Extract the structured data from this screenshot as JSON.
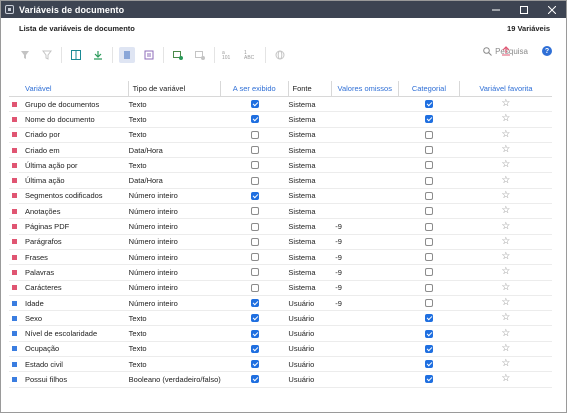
{
  "window": {
    "title": "Variáveis de documento"
  },
  "subheader": {
    "title": "Lista de variáveis de documento",
    "count": "19 Variáveis"
  },
  "toolbar": {
    "search_label": "Pesquisa",
    "help_label": "?"
  },
  "colors": {
    "accent": "#2f6fd6",
    "system_marker": "#e05572",
    "user_marker": "#3a7de0",
    "titlebar": "#3d4452"
  },
  "table": {
    "headers": {
      "name": "Variável",
      "type": "Tipo de variável",
      "display": "A ser exibido",
      "source": "Fonte",
      "missing": "Valores omissos",
      "categorical": "Categorial",
      "favorite": "Variável favorita"
    },
    "rows": [
      {
        "name": "Grupo de documentos",
        "type": "Texto",
        "display": true,
        "source": "Sistema",
        "missing": "",
        "categorical": true,
        "kind": "system"
      },
      {
        "name": "Nome do documento",
        "type": "Texto",
        "display": true,
        "source": "Sistema",
        "missing": "",
        "categorical": true,
        "kind": "system"
      },
      {
        "name": "Criado por",
        "type": "Texto",
        "display": false,
        "source": "Sistema",
        "missing": "",
        "categorical": false,
        "kind": "system"
      },
      {
        "name": "Criado em",
        "type": "Data/Hora",
        "display": false,
        "source": "Sistema",
        "missing": "",
        "categorical": false,
        "kind": "system"
      },
      {
        "name": "Última ação por",
        "type": "Texto",
        "display": false,
        "source": "Sistema",
        "missing": "",
        "categorical": false,
        "kind": "system"
      },
      {
        "name": "Última ação",
        "type": "Data/Hora",
        "display": false,
        "source": "Sistema",
        "missing": "",
        "categorical": false,
        "kind": "system"
      },
      {
        "name": "Segmentos codificados",
        "type": "Número inteiro",
        "display": true,
        "source": "Sistema",
        "missing": "",
        "categorical": false,
        "kind": "system"
      },
      {
        "name": "Anotações",
        "type": "Número inteiro",
        "display": false,
        "source": "Sistema",
        "missing": "",
        "categorical": false,
        "kind": "system"
      },
      {
        "name": "Páginas PDF",
        "type": "Número inteiro",
        "display": false,
        "source": "Sistema",
        "missing": "-9",
        "categorical": false,
        "kind": "system"
      },
      {
        "name": "Parágrafos",
        "type": "Número inteiro",
        "display": false,
        "source": "Sistema",
        "missing": "-9",
        "categorical": false,
        "kind": "system"
      },
      {
        "name": "Frases",
        "type": "Número inteiro",
        "display": false,
        "source": "Sistema",
        "missing": "-9",
        "categorical": false,
        "kind": "system"
      },
      {
        "name": "Palavras",
        "type": "Número inteiro",
        "display": false,
        "source": "Sistema",
        "missing": "-9",
        "categorical": false,
        "kind": "system"
      },
      {
        "name": "Carácteres",
        "type": "Número inteiro",
        "display": false,
        "source": "Sistema",
        "missing": "-9",
        "categorical": false,
        "kind": "system"
      },
      {
        "name": "Idade",
        "type": "Número inteiro",
        "display": true,
        "source": "Usuário",
        "missing": "-9",
        "categorical": false,
        "kind": "user"
      },
      {
        "name": "Sexo",
        "type": "Texto",
        "display": true,
        "source": "Usuário",
        "missing": "",
        "categorical": true,
        "kind": "user"
      },
      {
        "name": "Nível de escolaridade",
        "type": "Texto",
        "display": true,
        "source": "Usuário",
        "missing": "",
        "categorical": true,
        "kind": "user"
      },
      {
        "name": "Ocupação",
        "type": "Texto",
        "display": true,
        "source": "Usuário",
        "missing": "",
        "categorical": true,
        "kind": "user"
      },
      {
        "name": "Estado civil",
        "type": "Texto",
        "display": true,
        "source": "Usuário",
        "missing": "",
        "categorical": true,
        "kind": "user"
      },
      {
        "name": "Possui filhos",
        "type": "Booleano (verdadeiro/falso)",
        "display": true,
        "source": "Usuário",
        "missing": "",
        "categorical": true,
        "kind": "user"
      }
    ]
  }
}
